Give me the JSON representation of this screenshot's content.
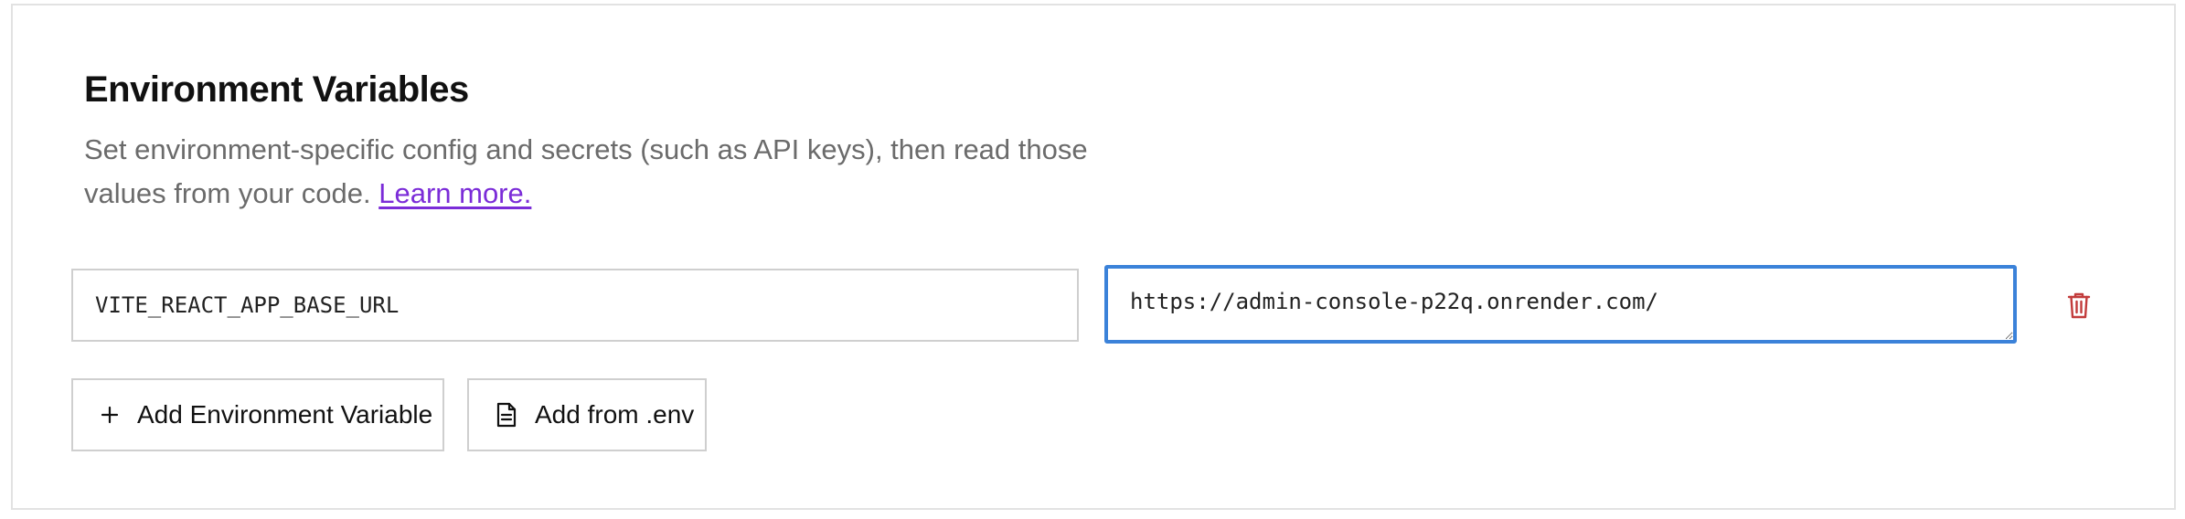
{
  "section": {
    "title": "Environment Variables",
    "description": "Set environment-specific config and secrets (such as API keys), then read those values from your code.",
    "learn_more": "Learn more."
  },
  "env_vars": [
    {
      "key": "VITE_REACT_APP_BASE_URL",
      "value": "https://admin-console-p22q.onrender.com/"
    }
  ],
  "actions": {
    "add_variable": "Add Environment Variable",
    "add_from_env": "Add from .env"
  },
  "icons": {
    "plus": "plus-icon",
    "file": "file-icon",
    "delete": "trash-icon"
  },
  "colors": {
    "link": "#7b2cd8",
    "focus_border": "#3b82d9",
    "delete": "#c23b3b",
    "muted_text": "#6b6b6b"
  }
}
